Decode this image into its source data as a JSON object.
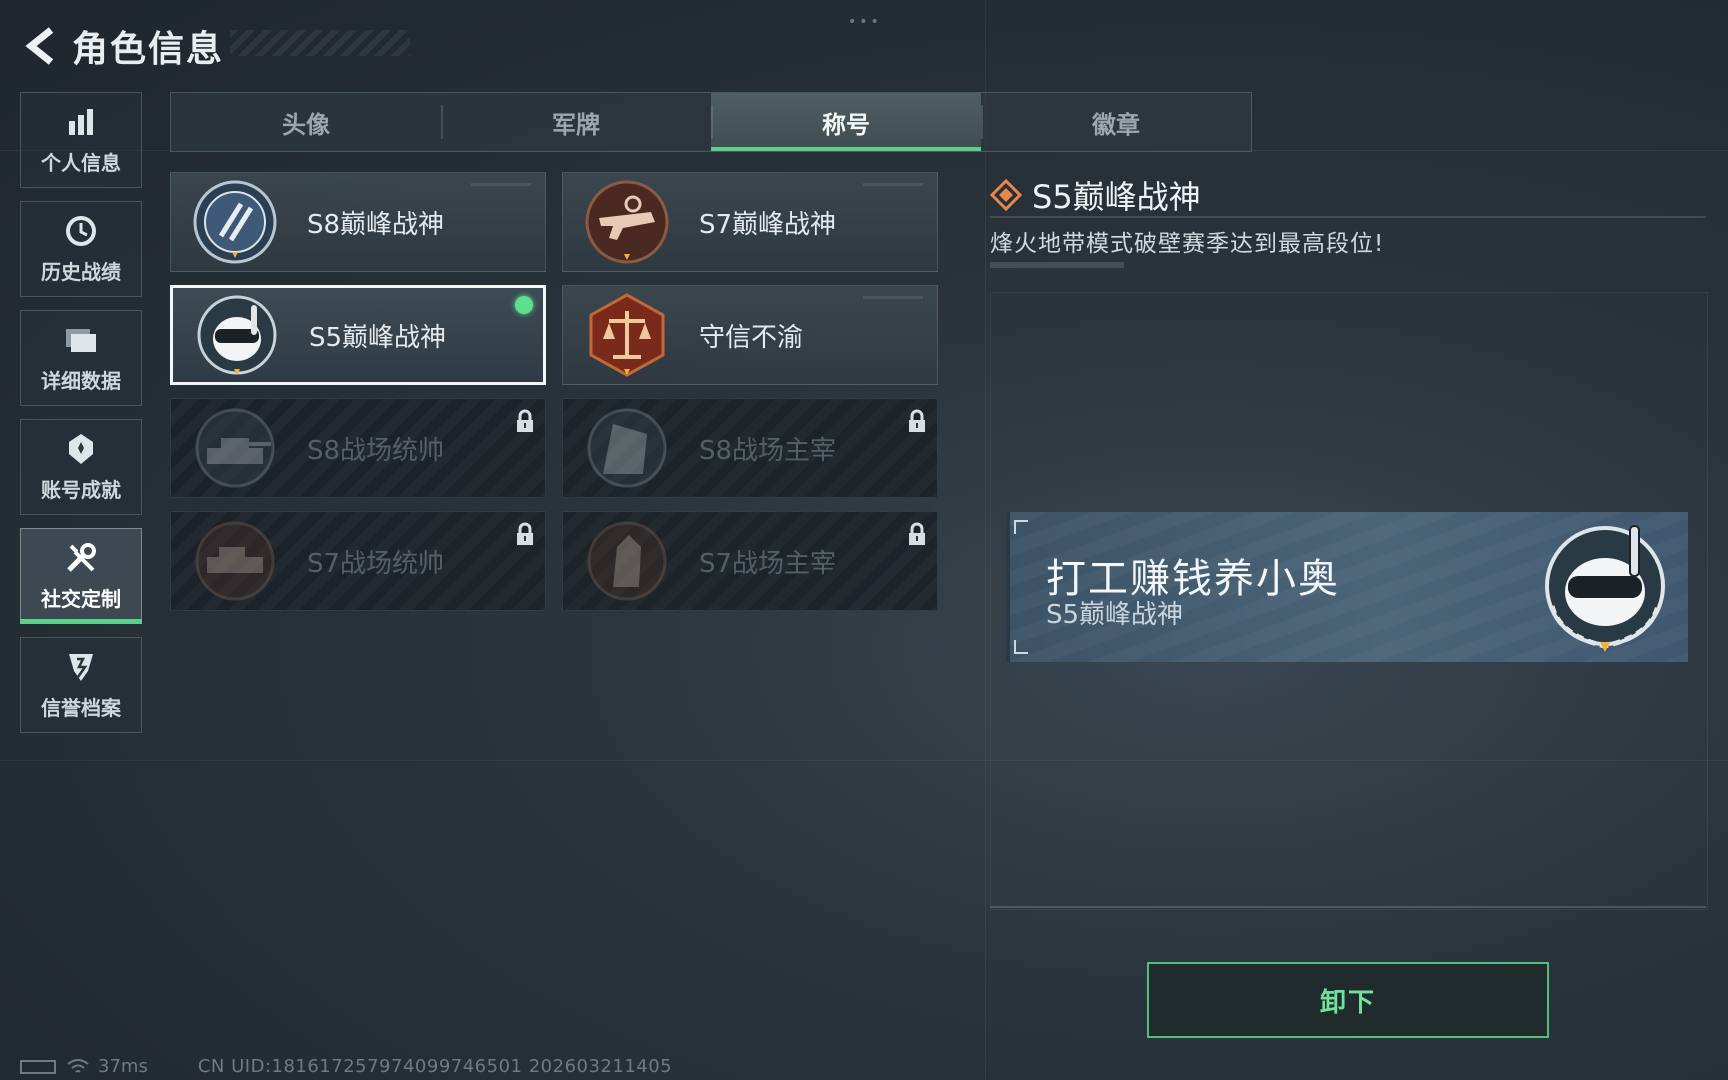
{
  "header": {
    "title": "角色信息"
  },
  "sidebar": {
    "items": [
      {
        "label": "个人信息",
        "icon": "bar-chart-icon",
        "active": false
      },
      {
        "label": "历史战绩",
        "icon": "history-icon",
        "active": false
      },
      {
        "label": "详细数据",
        "icon": "folder-icon",
        "active": false
      },
      {
        "label": "账号成就",
        "icon": "medal-icon",
        "active": false
      },
      {
        "label": "社交定制",
        "icon": "tools-icon",
        "active": true
      },
      {
        "label": "信誉档案",
        "icon": "shield-icon",
        "active": false
      }
    ]
  },
  "tabs": [
    {
      "label": "头像",
      "active": false
    },
    {
      "label": "军牌",
      "active": false
    },
    {
      "label": "称号",
      "active": true
    },
    {
      "label": "徽章",
      "active": false
    }
  ],
  "titles": [
    {
      "label": "S8巅峰战神",
      "emblem": "s8-peak-emblem",
      "state": "unlocked"
    },
    {
      "label": "S7巅峰战神",
      "emblem": "s7-peak-emblem",
      "state": "unlocked"
    },
    {
      "label": "S5巅峰战神",
      "emblem": "s5-peak-emblem",
      "state": "equipped"
    },
    {
      "label": "守信不渝",
      "emblem": "scales-emblem",
      "state": "unlocked"
    },
    {
      "label": "S8战场统帅",
      "emblem": "tank-emblem",
      "state": "locked"
    },
    {
      "label": "S8战场主宰",
      "emblem": "building-emblem",
      "state": "locked"
    },
    {
      "label": "S7战场统帅",
      "emblem": "vehicle-emblem",
      "state": "locked"
    },
    {
      "label": "S7战场主宰",
      "emblem": "soldier-emblem",
      "state": "locked"
    }
  ],
  "detail": {
    "title": "S5巅峰战神",
    "description": "烽火地带模式破壁赛季达到最高段位!"
  },
  "preview": {
    "player_name": "打工赚钱养小奥",
    "title": "S5巅峰战神"
  },
  "actions": {
    "unequip_label": "卸下"
  },
  "footer": {
    "ping": "37ms",
    "uid": "CN UID:1816172579740997465​01 202603211405"
  },
  "colors": {
    "accent_green": "#5ad08a",
    "background": "#2a333b",
    "selected_border": "#f4f7f8"
  }
}
